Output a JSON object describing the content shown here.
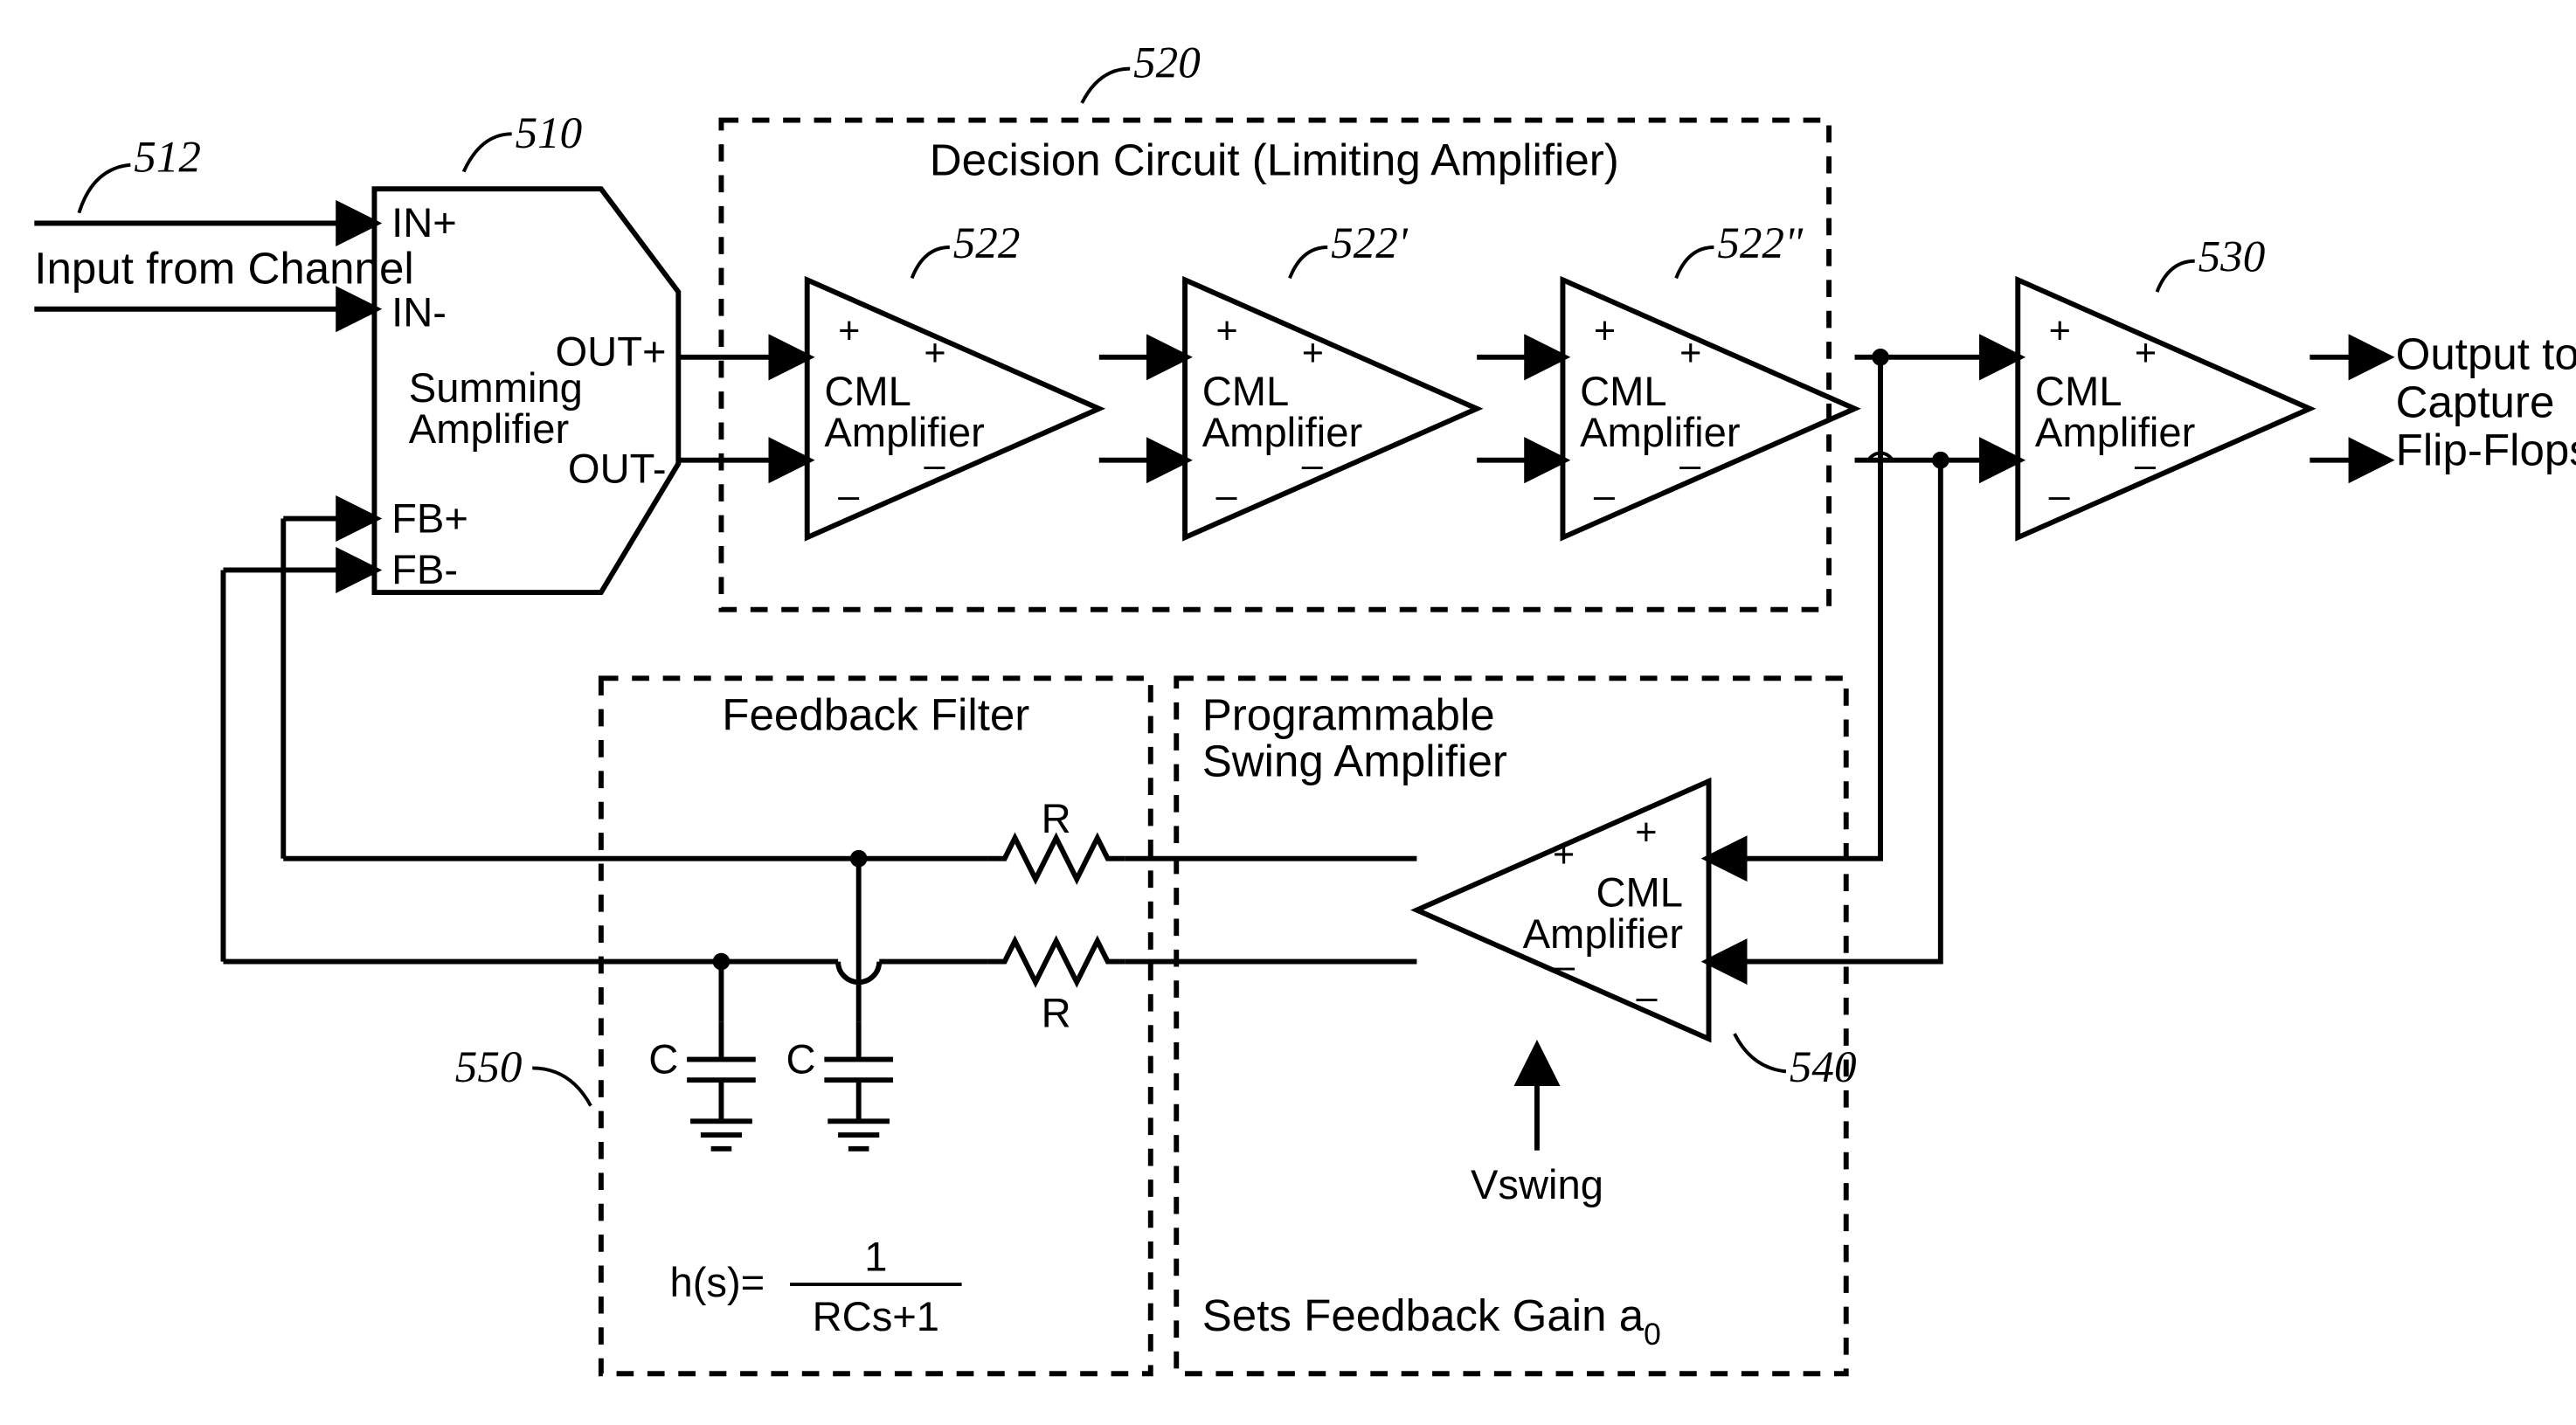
{
  "refs": {
    "input_leader": "512",
    "summing_amp": "510",
    "decision_box": "520",
    "cml1": "522",
    "cml2": "522'",
    "cml3": "522\"",
    "out_amp": "530",
    "swing_amp": "540",
    "filter_box": "550"
  },
  "labels": {
    "input": "Input from Channel",
    "decision_title": "Decision Circuit (Limiting Amplifier)",
    "summing_block": "Summing\nAmplifier",
    "cml_block": "CML\nAmplifier",
    "filter_title": "Feedback Filter",
    "swing_title": "Programmable\nSwing Amplifier",
    "swing_ctrl": "Vswing",
    "swing_note": "Sets Feedback Gain a",
    "swing_note_sub": "0",
    "output": "Output to\nCapture\nFlip-Flops",
    "hfunc_lhs": "h(s)=",
    "hfunc_num": "1",
    "hfunc_den": "RCs+1",
    "R": "R",
    "C": "C",
    "IN_P": "IN+",
    "IN_M": "IN-",
    "OUT_P": "OUT+",
    "OUT_M": "OUT-",
    "FB_P": "FB+",
    "FB_M": "FB-"
  }
}
